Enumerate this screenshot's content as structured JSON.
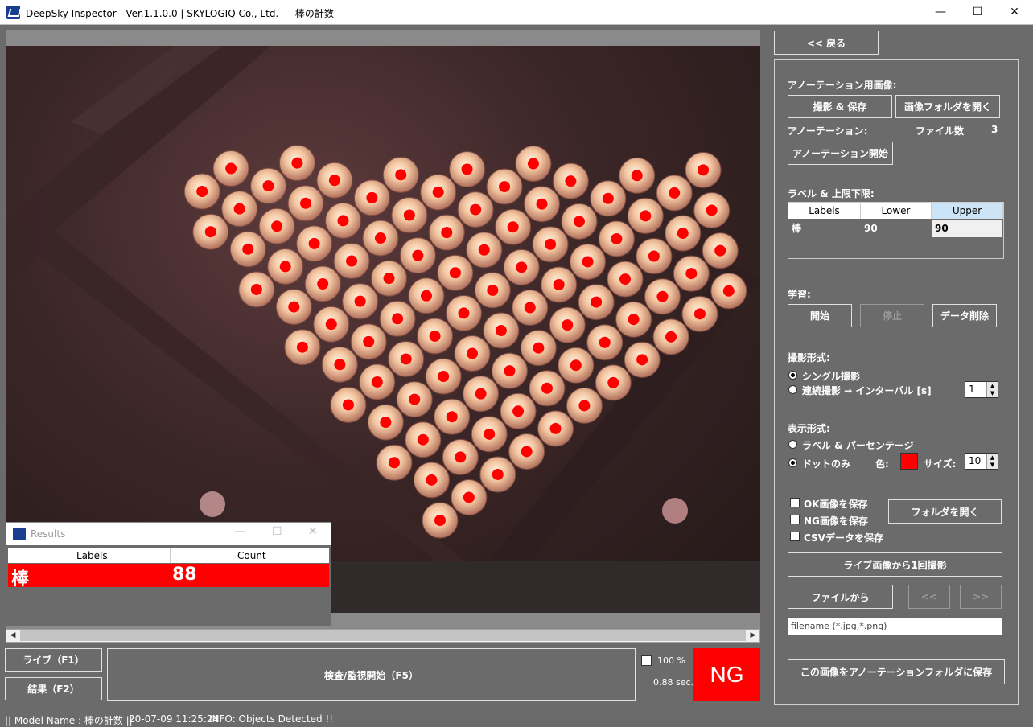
{
  "window": {
    "title": "DeepSky Inspector | Ver.1.1.0.0 | SKYLOGIQ Co., Ltd. --- 棒の計数",
    "min": "—",
    "max": "☐",
    "close": "✕"
  },
  "results_window": {
    "title": "Results",
    "min": "—",
    "max": "☐",
    "close": "✕",
    "col_labels": "Labels",
    "col_count": "Count",
    "rows": [
      {
        "label": "棒",
        "count": "88"
      }
    ]
  },
  "bottom": {
    "live_button": "ライブ（F1）",
    "result_button": "結果（F2）",
    "inspect_button": "検査/監視開始（F5）",
    "zoom_label": "100 %",
    "elapsed": "0.88 sec.",
    "verdict": "NG"
  },
  "status": {
    "model": "|| Model Name : 棒の計数 ||",
    "timestamp": "20-07-09 11:25:24",
    "info": "INFO:   Objects Detected !!"
  },
  "right": {
    "back_button": "<< 戻る",
    "annotation_images_label": "アノーテーション用画像:",
    "capture_save_button": "撮影 & 保存",
    "open_image_folder_button": "画像フォルダを開く",
    "annotation_label": "アノーテーション:",
    "file_count_label": "ファイル数",
    "file_count": "3",
    "start_annotation_button": "アノーテーション開始",
    "labels_limits_label": "ラベル & 上限下限:",
    "table_headers": [
      "Labels",
      "Lower",
      "Upper"
    ],
    "table_rows": [
      {
        "label": "棒",
        "lower": "90",
        "upper": "90"
      }
    ],
    "learning_label": "学習:",
    "start_button": "開始",
    "stop_button": "停止",
    "delete_data_button": "データ削除",
    "capture_mode_label": "撮影形式:",
    "single_capture": "シングル撮影",
    "continuous_capture": "連続撮影 → インターバル [s]",
    "interval_value": "1",
    "display_mode_label": "表示形式:",
    "label_percentage": "ラベル & パーセンテージ",
    "dots_only": "ドットのみ",
    "color_label": "色:",
    "dot_color": "#ff0000",
    "size_label": "サイズ:",
    "size_value": "10",
    "save_ok": "OK画像を保存",
    "save_ng": "NG画像を保存",
    "save_csv": "CSVデータを保存",
    "open_folder_button": "フォルダを開く",
    "capture_once_button": "ライブ画像から1回撮影",
    "from_file_button": "ファイルから",
    "prev_button": "<<",
    "next_button": ">>",
    "filename_placeholder": "filename (*.jpg,*.png)",
    "save_to_annotation_button": "この画像をアノーテーションフォルダに保存"
  }
}
